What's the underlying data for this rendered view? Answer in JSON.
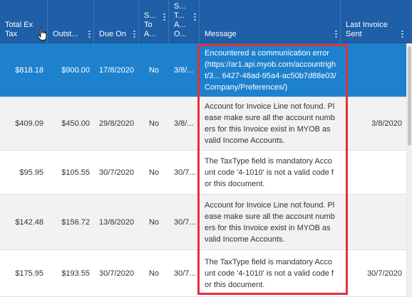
{
  "columns": [
    {
      "label": "Total Ex\nTax"
    },
    {
      "label": "Outst..."
    },
    {
      "label": "Due On"
    },
    {
      "label": "S...\nTo\nA..."
    },
    {
      "label": "S...\nT...\nA...\nO..."
    },
    {
      "label": "Message"
    },
    {
      "label": "Last Invoice\nSent"
    }
  ],
  "rows": [
    {
      "total_ex_tax": "$818.18",
      "outstanding": "$900.00",
      "due_on": "17/8/2020",
      "sent_to_accounting": "No",
      "status_date": "3/8/...",
      "message": "Encountered a communication error (https://ar1.api.myob.com/accountright/3... 6427-48ad-95a4-ac50b7d88e03/Company/Preferences/)",
      "last_invoice_sent": ""
    },
    {
      "total_ex_tax": "$409.09",
      "outstanding": "$450.00",
      "due_on": "29/8/2020",
      "sent_to_accounting": "No",
      "status_date": "3/8/...",
      "message": "Account for Invoice Line not found. Please make sure all the account numbers for this Invoice exist in MYOB as valid Income Accounts.",
      "last_invoice_sent": "3/8/2020"
    },
    {
      "total_ex_tax": "$95.95",
      "outstanding": "$105.55",
      "due_on": "30/7/2020",
      "sent_to_accounting": "No",
      "status_date": "30/7...",
      "message": "The TaxType field is mandatory Account code '4-1010' is not a valid code for this document.",
      "last_invoice_sent": ""
    },
    {
      "total_ex_tax": "$142.48",
      "outstanding": "$156.72",
      "due_on": "13/8/2020",
      "sent_to_accounting": "No",
      "status_date": "30/7...",
      "message": "Account for Invoice Line not found. Please make sure all the account numbers for this Invoice exist in MYOB as valid Income Accounts.",
      "last_invoice_sent": ""
    },
    {
      "total_ex_tax": "$175.95",
      "outstanding": "$193.55",
      "due_on": "30/7/2020",
      "sent_to_accounting": "No",
      "status_date": "30/7...",
      "message": "The TaxType field is mandatory Account code '4-1010' is not a valid code for this document.",
      "last_invoice_sent": "30/7/2020"
    }
  ],
  "colors": {
    "header": "#1f5fa7",
    "selected_row": "#1e81ce",
    "highlight_border": "#e0323a"
  }
}
